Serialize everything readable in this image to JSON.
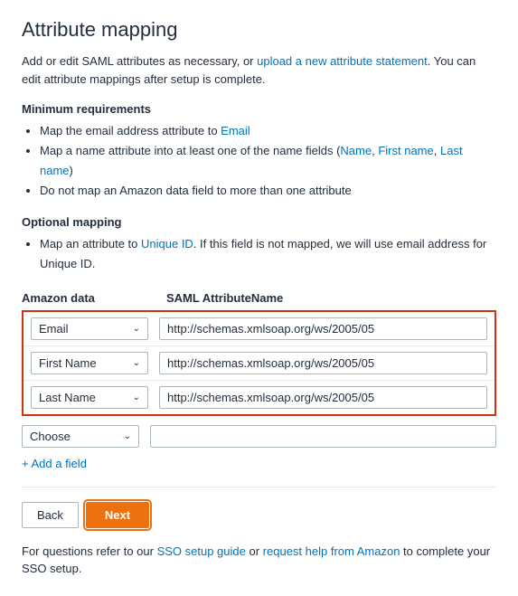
{
  "page": {
    "title": "Attribute mapping",
    "intro_text": "Add or edit SAML attributes as necessary, or ",
    "intro_link": "upload a new attribute statement",
    "intro_suffix": ". You can edit attribute mappings after setup is complete.",
    "min_req_title": "Minimum requirements",
    "min_req_items": [
      {
        "text": "Map the email address attribute to ",
        "link": "Email",
        "suffix": ""
      },
      {
        "text": "Map a name attribute into at least one of the name fields (",
        "links": [
          "Name",
          "First name",
          "Last name"
        ],
        "suffix": ")"
      },
      {
        "text": "Do not map an Amazon data field to more than one attribute",
        "link": null
      }
    ],
    "opt_title": "Optional mapping",
    "opt_items": [
      {
        "text": "Map an attribute to ",
        "link": "Unique ID",
        "suffix": ". If this field is not mapped, we will use email address for Unique ID."
      }
    ],
    "col_amazon": "Amazon data",
    "col_saml": "SAML AttributeName",
    "mapped_rows": [
      {
        "amazon_label": "Email",
        "saml_value": "http://schemas.xmlsoap.org/ws/2005/05"
      },
      {
        "amazon_label": "First Name",
        "saml_value": "http://schemas.xmlsoap.org/ws/2005/05"
      },
      {
        "amazon_label": "Last Name",
        "saml_value": "http://schemas.xmlsoap.org/ws/2005/05"
      }
    ],
    "choose_label": "Choose",
    "add_field_label": "+ Add a field",
    "btn_back": "Back",
    "btn_next": "Next",
    "footer_text1": "For questions refer to our ",
    "footer_link1": "SSO setup guide",
    "footer_text2": " or ",
    "footer_link2": "request help from Amazon",
    "footer_text3": " to complete your SSO setup."
  }
}
